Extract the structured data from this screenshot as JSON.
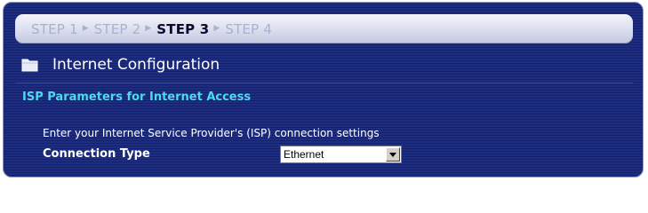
{
  "wizard": {
    "steps": [
      {
        "label": "STEP 1",
        "active": false
      },
      {
        "label": "STEP 2",
        "active": false
      },
      {
        "label": "STEP 3",
        "active": true
      },
      {
        "label": "STEP 4",
        "active": false
      }
    ]
  },
  "page": {
    "title": "Internet Configuration",
    "icon": "folder-icon"
  },
  "section": {
    "title": "ISP Parameters for Internet Access",
    "instructions": "Enter your Internet Service Provider's (ISP) connection settings"
  },
  "connection_type": {
    "label": "Connection Type",
    "selected": "Ethernet"
  },
  "colors": {
    "background": "#1b2b78",
    "section_title": "#4fd8f0",
    "active_step": "#0a0a30",
    "inactive_step": "#a9b0d3"
  }
}
